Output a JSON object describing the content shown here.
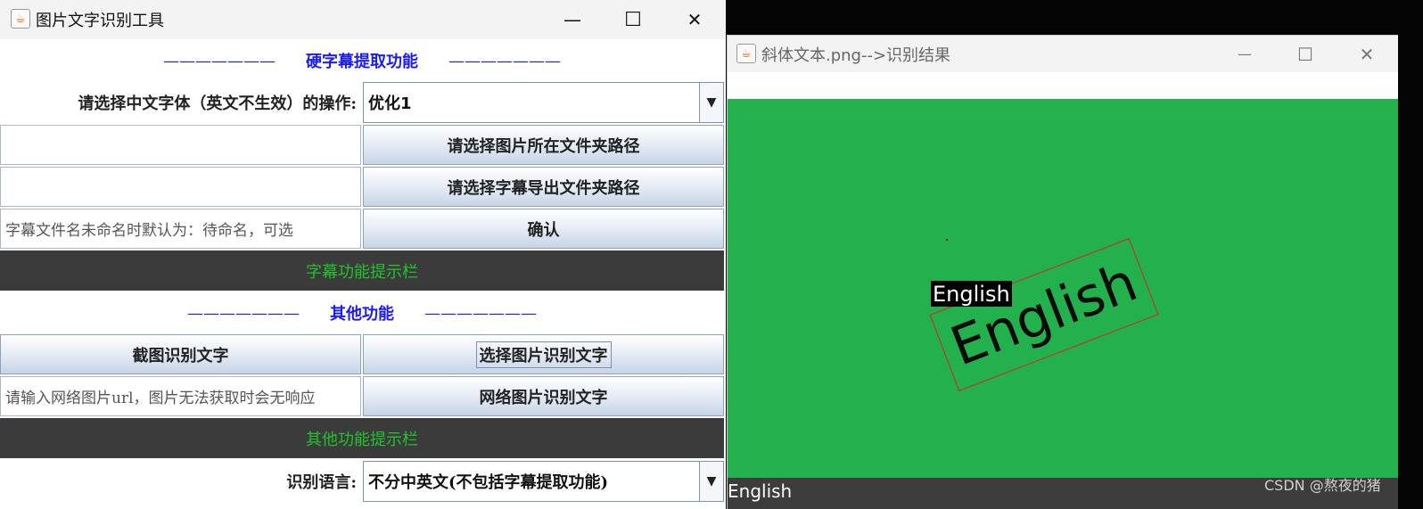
{
  "main_window": {
    "title": "图片文字识别工具",
    "controls": {
      "minimize": "—",
      "maximize": "☐",
      "close": "✕"
    },
    "subtitle_section": {
      "dash_left": "———————",
      "title": "硬字幕提取功能",
      "dash_right": "———————",
      "font_label": "请选择中文字体（英文不生效）的操作:",
      "font_value": "优化1",
      "select_image_folder_button": "请选择图片所在文件夹路径",
      "select_export_folder_button": "请选择字幕导出文件夹路径",
      "filename_placeholder": "字幕文件名未命名时默认为：待命名，可选",
      "confirm_button": "确认",
      "hint_bar": "字幕功能提示栏"
    },
    "other_section": {
      "dash_left": "———————",
      "title": "其他功能",
      "dash_right": "———————",
      "screenshot_button": "截图识别文字",
      "select_image_button": "选择图片识别文字",
      "url_placeholder": "请输入网络图片url，图片无法获取时会无响应",
      "url_button": "网络图片识别文字",
      "hint_bar": "其他功能提示栏",
      "language_label": "识别语言:",
      "language_value": "不分中英文(不包括字幕提取功能)"
    }
  },
  "result_window": {
    "title": "斜体文本.png-->识别结果",
    "controls": {
      "minimize": "—",
      "maximize": "☐",
      "close": "✕"
    },
    "detected_label": "English",
    "image_text": "English",
    "result_text": "English"
  },
  "watermark": "CSDN @熬夜的猪",
  "colors": {
    "section_title": "#1a1aff",
    "hint_text": "#22c22b",
    "hint_bar_bg": "#3b3b3b",
    "canvas_green": "#22b14c",
    "detection_box": "#e02020"
  }
}
